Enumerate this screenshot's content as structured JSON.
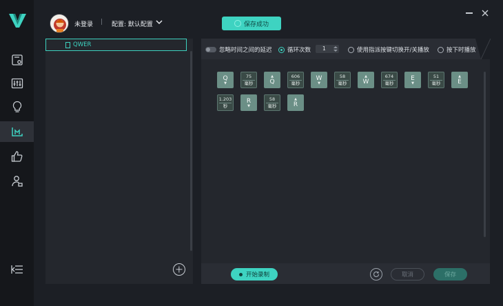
{
  "brand": {
    "logo": "v-logo-icon",
    "accent": "#3ed3c1"
  },
  "sidebar": {
    "items": [
      {
        "name": "macro-library-icon"
      },
      {
        "name": "equalizer-icon"
      },
      {
        "name": "lightbulb-icon"
      },
      {
        "name": "macro-icon",
        "active": true
      },
      {
        "name": "thumbs-up-icon"
      },
      {
        "name": "user-manage-icon"
      }
    ],
    "collapse_icon": "collapse-menu-icon"
  },
  "header": {
    "login_text": "未登录",
    "separator": "|",
    "profile_label": "配置: 默认配置",
    "toast": "保存成功"
  },
  "files": {
    "items": [
      {
        "label": "QWER"
      }
    ]
  },
  "options": {
    "ignore_delay": "忽略时间之间的延迟",
    "loop_label": "循环次数",
    "loop_value": "1",
    "toggle_key_label": "使用指派按键切换开/关播放",
    "press_play_label": "按下时播放"
  },
  "sequence": [
    {
      "type": "key",
      "label": "Q",
      "dir": "down"
    },
    {
      "type": "delay",
      "value": "75",
      "unit": "毫秒"
    },
    {
      "type": "key",
      "label": "Q",
      "dir": "up"
    },
    {
      "type": "delay",
      "value": "606",
      "unit": "毫秒"
    },
    {
      "type": "key",
      "label": "W",
      "dir": "down"
    },
    {
      "type": "delay",
      "value": "58",
      "unit": "毫秒"
    },
    {
      "type": "key",
      "label": "W",
      "dir": "up"
    },
    {
      "type": "delay",
      "value": "674",
      "unit": "毫秒"
    },
    {
      "type": "key",
      "label": "E",
      "dir": "down"
    },
    {
      "type": "delay",
      "value": "51",
      "unit": "毫秒"
    },
    {
      "type": "key",
      "label": "E",
      "dir": "up"
    },
    {
      "type": "delay",
      "value": "1.203",
      "unit": "秒"
    },
    {
      "type": "key",
      "label": "R",
      "dir": "down"
    },
    {
      "type": "delay",
      "value": "58",
      "unit": "毫秒"
    },
    {
      "type": "key",
      "label": "R",
      "dir": "up"
    }
  ],
  "footer": {
    "record_label": "开始录制",
    "cancel_label": "取消",
    "save_label": "保存"
  }
}
